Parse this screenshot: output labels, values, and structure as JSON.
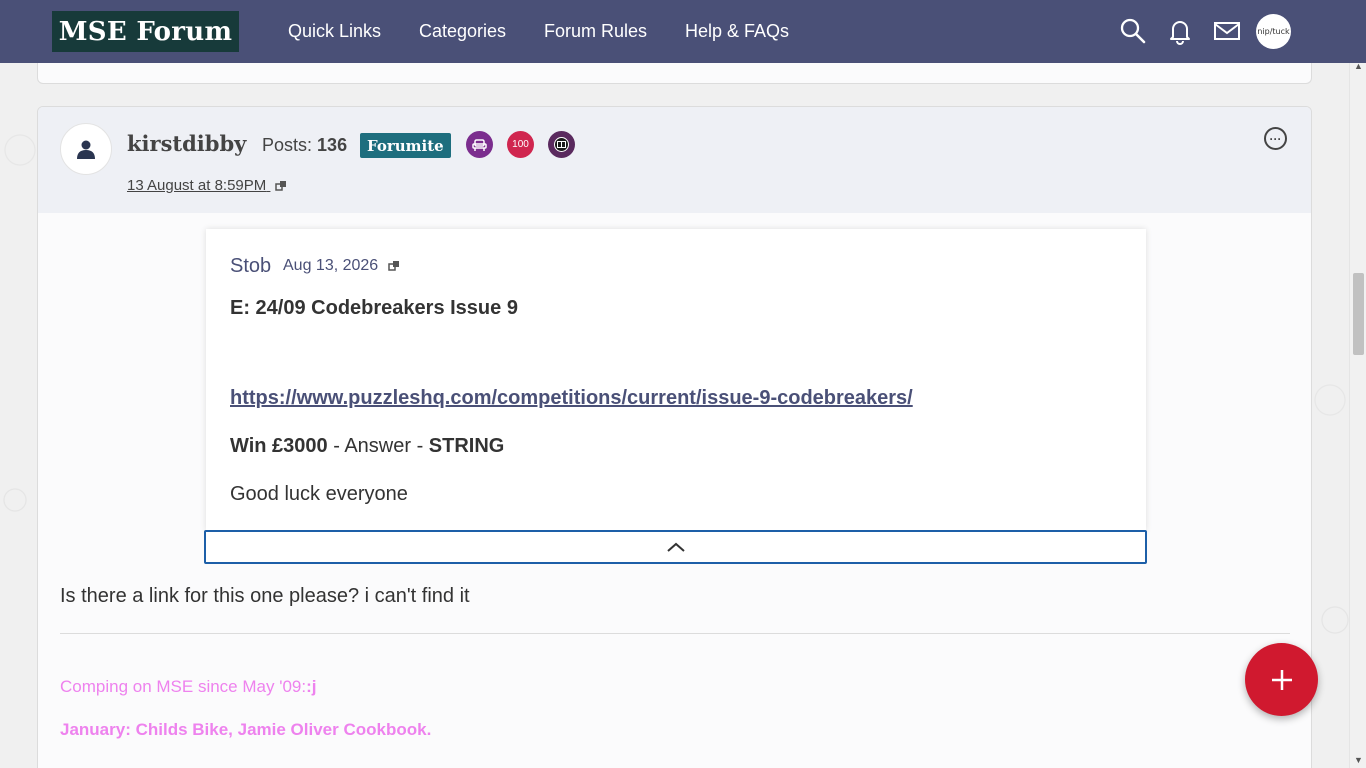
{
  "header": {
    "logo": "MSE Forum",
    "nav": [
      "Quick Links",
      "Categories",
      "Forum Rules",
      "Help & FAQs"
    ],
    "icons": [
      "search-icon",
      "bell-icon",
      "envelope-icon"
    ],
    "avatar_text": "nip/tuck"
  },
  "post": {
    "username": "kirstdibby",
    "posts_label": "Posts:",
    "posts_count": "136",
    "rank": "Forumite",
    "badges": [
      {
        "name": "armchair-badge",
        "color": "#7b2d8e"
      },
      {
        "name": "100-badge",
        "label": "100",
        "color": "#d0264f"
      },
      {
        "name": "film-badge",
        "color": "#5a2a5e"
      }
    ],
    "date": "13 August at 8:59PM",
    "quote": {
      "author": "Stob",
      "date": "Aug 13, 2026",
      "title": "E: 24/09 Codebreakers Issue 9",
      "link": "https://www.puzzleshq.com/competitions/current/issue-9-codebreakers/",
      "win_bold": "Win £3000",
      "win_mid": " - Answer - ",
      "win_answer": "STRING",
      "luck": "Good luck everyone"
    },
    "body": "Is there a link for this one please? i can't find it",
    "signature": {
      "line1_text": "Comping on MSE since May '09:",
      "line1_bold": ":j",
      "line2": "January: Childs Bike, Jamie Oliver Cookbook."
    }
  },
  "colors": {
    "nav_bg": "#4a5077",
    "logo_bg": "#173a3a",
    "rank_bg": "#1e6e7e",
    "fab_bg": "#d0192f",
    "signature": "#ee82ee"
  },
  "fab_icon": "plus-icon"
}
